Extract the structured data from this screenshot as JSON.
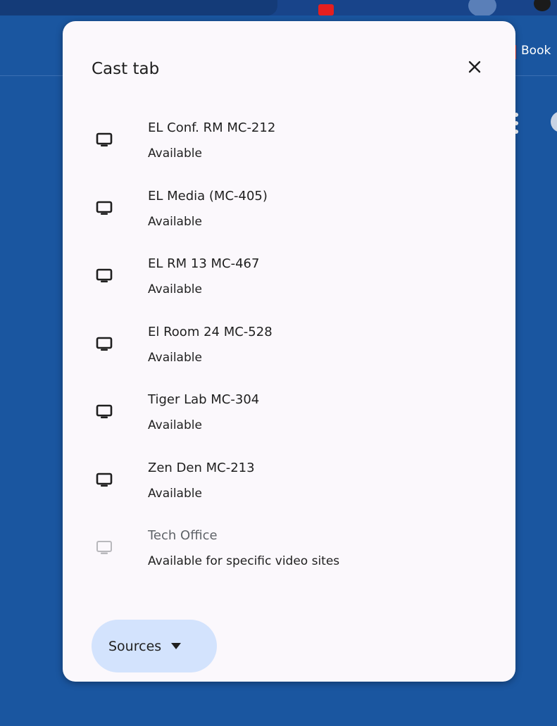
{
  "dialog": {
    "title": "Cast tab",
    "close_icon": "close-icon"
  },
  "background": {
    "bookmark_label": "Book",
    "colors": {
      "page": "#1a56a0",
      "dialog": "#fbf8fc",
      "sources_button": "#d3e3fd"
    }
  },
  "sinks": [
    {
      "name": "EL Conf. RM MC-212",
      "status": "Available",
      "icon": "tv-icon",
      "enabled": true
    },
    {
      "name": "EL Media (MC-405)",
      "status": "Available",
      "icon": "tv-icon",
      "enabled": true
    },
    {
      "name": "EL RM 13 MC-467",
      "status": "Available",
      "icon": "tv-icon",
      "enabled": true
    },
    {
      "name": "El Room 24 MC-528",
      "status": "Available",
      "icon": "tv-icon",
      "enabled": true
    },
    {
      "name": "Tiger Lab MC-304",
      "status": "Available",
      "icon": "tv-icon",
      "enabled": true
    },
    {
      "name": "Zen Den MC-213",
      "status": "Available",
      "icon": "tv-icon",
      "enabled": true
    },
    {
      "name": "Tech Office",
      "status": "Available for specific video sites",
      "icon": "tv-icon",
      "enabled": false
    }
  ],
  "sources_button": {
    "label": "Sources",
    "icon": "dropdown-caret-icon"
  }
}
